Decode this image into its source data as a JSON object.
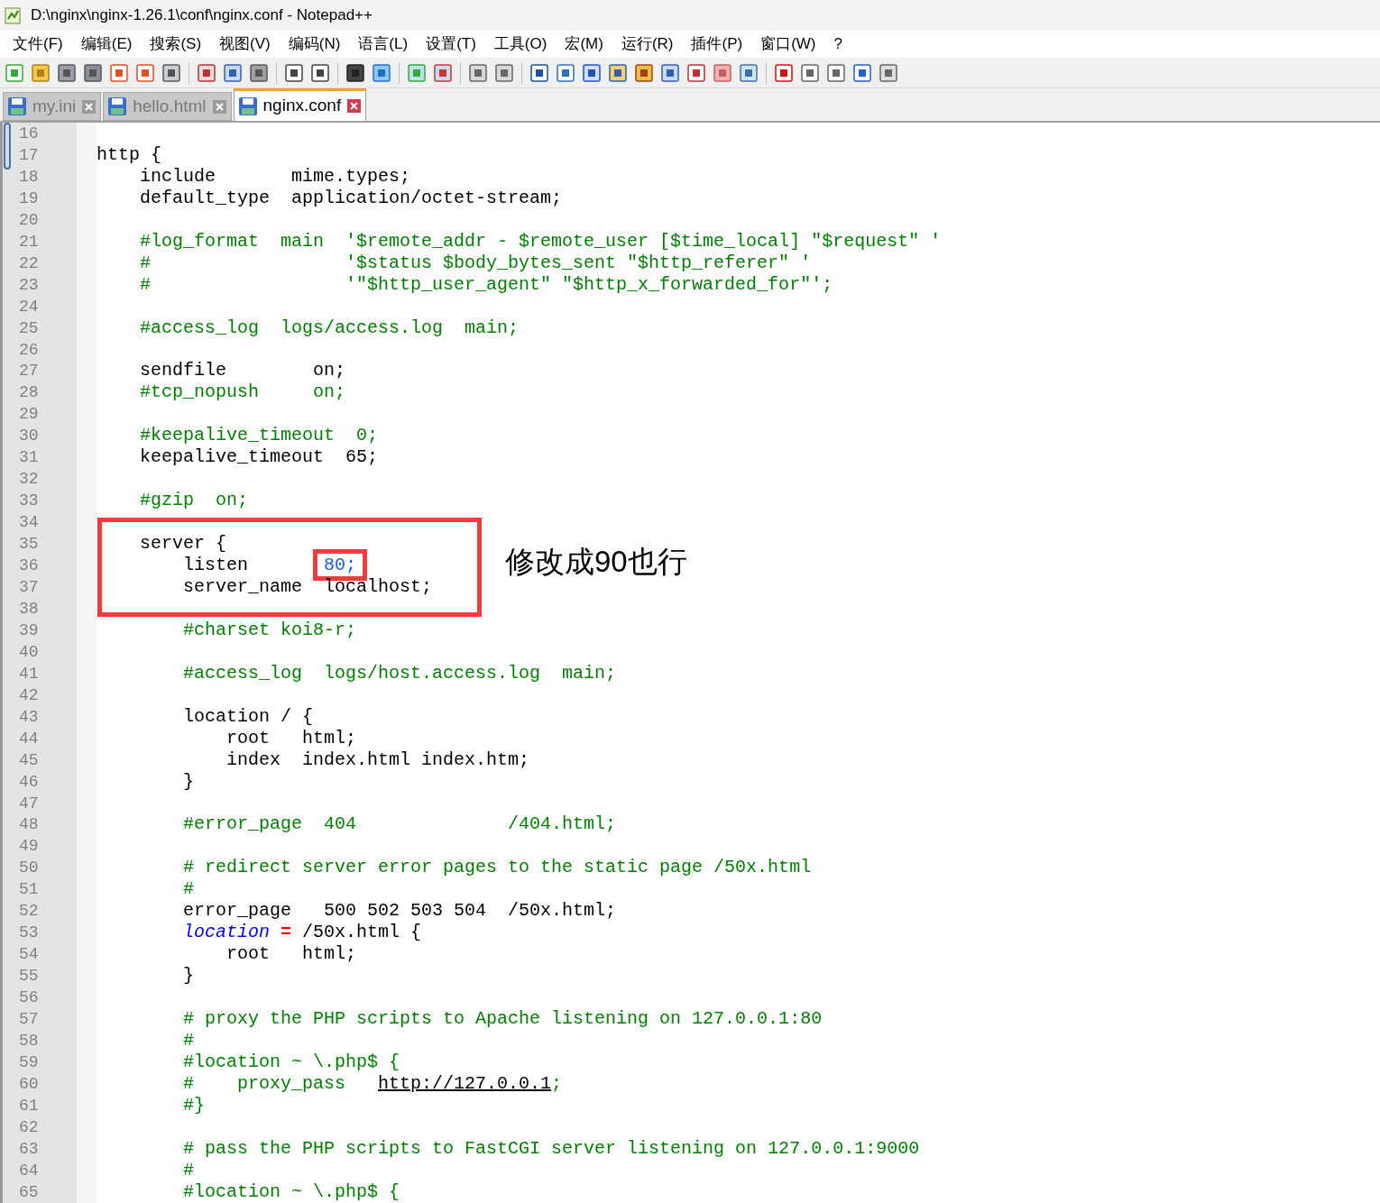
{
  "window": {
    "title": "D:\\nginx\\nginx-1.26.1\\conf\\nginx.conf - Notepad++"
  },
  "menu": [
    "文件(F)",
    "编辑(E)",
    "搜索(S)",
    "视图(V)",
    "编码(N)",
    "语言(L)",
    "设置(T)",
    "工具(O)",
    "宏(M)",
    "运行(R)",
    "插件(P)",
    "窗口(W)",
    "?"
  ],
  "tabs": [
    {
      "label": "my.ini",
      "selected": false
    },
    {
      "label": "hello.html",
      "selected": false
    },
    {
      "label": "nginx.conf",
      "selected": true
    }
  ],
  "editor": {
    "lines": [
      {
        "number": "16"
      },
      {
        "number": "17",
        "segments": [
          {
            "text": "http {",
            "kind": "plain"
          }
        ]
      },
      {
        "number": "18",
        "segments": [
          {
            "text": "    include       mime.types;",
            "kind": "plain"
          }
        ]
      },
      {
        "number": "19",
        "segments": [
          {
            "text": "    default_type  application/octet-stream;",
            "kind": "plain"
          }
        ]
      },
      {
        "number": "20"
      },
      {
        "number": "21",
        "segments": [
          {
            "text": "    #log_format  main  '$remote_addr - $remote_user [$time_local] \"$request\" '",
            "kind": "comment"
          }
        ]
      },
      {
        "number": "22",
        "segments": [
          {
            "text": "    #                  '$status $body_bytes_sent \"$http_referer\" '",
            "kind": "comment"
          }
        ]
      },
      {
        "number": "23",
        "segments": [
          {
            "text": "    #                  '\"$http_user_agent\" \"$http_x_forwarded_for\"';",
            "kind": "comment"
          }
        ]
      },
      {
        "number": "24"
      },
      {
        "number": "25",
        "segments": [
          {
            "text": "    #access_log  logs/access.log  main;",
            "kind": "comment"
          }
        ]
      },
      {
        "number": "26"
      },
      {
        "number": "27",
        "segments": [
          {
            "text": "    sendfile        on;",
            "kind": "plain"
          }
        ]
      },
      {
        "number": "28",
        "segments": [
          {
            "text": "    #tcp_nopush     on;",
            "kind": "comment"
          }
        ]
      },
      {
        "number": "29"
      },
      {
        "number": "30",
        "segments": [
          {
            "text": "    #keepalive_timeout  0;",
            "kind": "comment"
          }
        ]
      },
      {
        "number": "31",
        "segments": [
          {
            "text": "    keepalive_timeout  65;",
            "kind": "plain"
          }
        ]
      },
      {
        "number": "32"
      },
      {
        "number": "33",
        "segments": [
          {
            "text": "    #gzip  on;",
            "kind": "comment"
          }
        ]
      },
      {
        "number": "34"
      },
      {
        "number": "35",
        "segments": [
          {
            "text": "    server {",
            "kind": "plain"
          }
        ]
      },
      {
        "number": "36",
        "segments": [
          {
            "text": "        listen      ",
            "kind": "plain"
          },
          {
            "text": "80;",
            "kind": "number",
            "boxed": true
          }
        ]
      },
      {
        "number": "37",
        "segments": [
          {
            "text": "        server_name  localhost;",
            "kind": "plain"
          }
        ]
      },
      {
        "number": "38"
      },
      {
        "number": "39",
        "segments": [
          {
            "text": "        #charset koi8-r;",
            "kind": "comment"
          }
        ]
      },
      {
        "number": "40"
      },
      {
        "number": "41",
        "segments": [
          {
            "text": "        #access_log  logs/host.access.log  main;",
            "kind": "comment"
          }
        ]
      },
      {
        "number": "42"
      },
      {
        "number": "43",
        "segments": [
          {
            "text": "        location / {",
            "kind": "plain"
          }
        ]
      },
      {
        "number": "44",
        "segments": [
          {
            "text": "            root   html;",
            "kind": "plain"
          }
        ]
      },
      {
        "number": "45",
        "segments": [
          {
            "text": "            index  index.html index.htm;",
            "kind": "plain"
          }
        ]
      },
      {
        "number": "46",
        "segments": [
          {
            "text": "        }",
            "kind": "plain"
          }
        ]
      },
      {
        "number": "47"
      },
      {
        "number": "48",
        "segments": [
          {
            "text": "        #error_page  404              /404.html;",
            "kind": "comment"
          }
        ]
      },
      {
        "number": "49"
      },
      {
        "number": "50",
        "segments": [
          {
            "text": "        # redirect server error pages to the static page /50x.html",
            "kind": "comment"
          }
        ]
      },
      {
        "number": "51",
        "segments": [
          {
            "text": "        #",
            "kind": "comment"
          }
        ]
      },
      {
        "number": "52",
        "segments": [
          {
            "text": "        error_page   500 502 503 504  /50x.html;",
            "kind": "plain"
          }
        ]
      },
      {
        "number": "53",
        "segments": [
          {
            "text": "        location",
            "kind": "keyword"
          },
          {
            "text": " =",
            "kind": "operator"
          },
          {
            "text": " /50x.html {",
            "kind": "plain"
          }
        ]
      },
      {
        "number": "54",
        "segments": [
          {
            "text": "            root   html;",
            "kind": "plain"
          }
        ]
      },
      {
        "number": "55",
        "segments": [
          {
            "text": "        }",
            "kind": "plain"
          }
        ]
      },
      {
        "number": "56"
      },
      {
        "number": "57",
        "segments": [
          {
            "text": "        # proxy the PHP scripts to Apache listening on 127.0.0.1:80",
            "kind": "comment"
          }
        ]
      },
      {
        "number": "58",
        "segments": [
          {
            "text": "        #",
            "kind": "comment"
          }
        ]
      },
      {
        "number": "59",
        "segments": [
          {
            "text": "        #location ~ \\.php$ {",
            "kind": "comment"
          }
        ]
      },
      {
        "number": "60",
        "segments": [
          {
            "text": "        #    proxy_pass   ",
            "kind": "comment"
          },
          {
            "text": "http://127.0.0.1",
            "kind": "link"
          },
          {
            "text": ";",
            "kind": "comment"
          }
        ]
      },
      {
        "number": "61",
        "segments": [
          {
            "text": "        #}",
            "kind": "comment"
          }
        ]
      },
      {
        "number": "62"
      },
      {
        "number": "63",
        "segments": [
          {
            "text": "        # pass the PHP scripts to FastCGI server listening on 127.0.0.1:9000",
            "kind": "comment"
          }
        ]
      },
      {
        "number": "64",
        "segments": [
          {
            "text": "        #",
            "kind": "comment"
          }
        ]
      },
      {
        "number": "65",
        "segments": [
          {
            "text": "        #location ~ \\.php$ {",
            "kind": "comment"
          }
        ]
      }
    ]
  },
  "annotation": {
    "label": "修改成90也行"
  }
}
